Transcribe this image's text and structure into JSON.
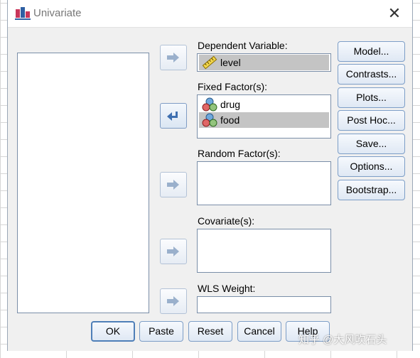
{
  "window": {
    "title": "Univariate",
    "close_glyph": "✕"
  },
  "fields": {
    "dependent": {
      "label": "Dependent Variable:",
      "items": [
        {
          "name": "level",
          "icon": "scale-variable-icon",
          "selected": true
        }
      ]
    },
    "fixed": {
      "label": "Fixed Factor(s):",
      "items": [
        {
          "name": "drug",
          "icon": "nominal-variable-icon",
          "selected": false
        },
        {
          "name": "food",
          "icon": "nominal-variable-icon",
          "selected": true
        }
      ]
    },
    "random": {
      "label": "Random Factor(s):",
      "items": []
    },
    "covariate": {
      "label": "Covariate(s):",
      "items": []
    },
    "wls": {
      "label": "WLS Weight:",
      "items": []
    }
  },
  "side_buttons": [
    "Model...",
    "Contrasts...",
    "Plots...",
    "Post Hoc...",
    "Save...",
    "Options...",
    "Bootstrap..."
  ],
  "bottom_buttons": [
    "OK",
    "Paste",
    "Reset",
    "Cancel",
    "Help"
  ],
  "arrow_buttons": [
    {
      "target": "dependent",
      "direction": "right"
    },
    {
      "target": "fixed",
      "direction": "left"
    },
    {
      "target": "random",
      "direction": "right"
    },
    {
      "target": "covariate",
      "direction": "right"
    },
    {
      "target": "wls",
      "direction": "right"
    }
  ],
  "watermark": "知乎 @大风吹石头",
  "colors": {
    "selection": "#c4c4c4",
    "dialog_bg": "#f0f0f0",
    "button_border": "#7d9ec7",
    "arrow_active": "#3e6fb0"
  }
}
